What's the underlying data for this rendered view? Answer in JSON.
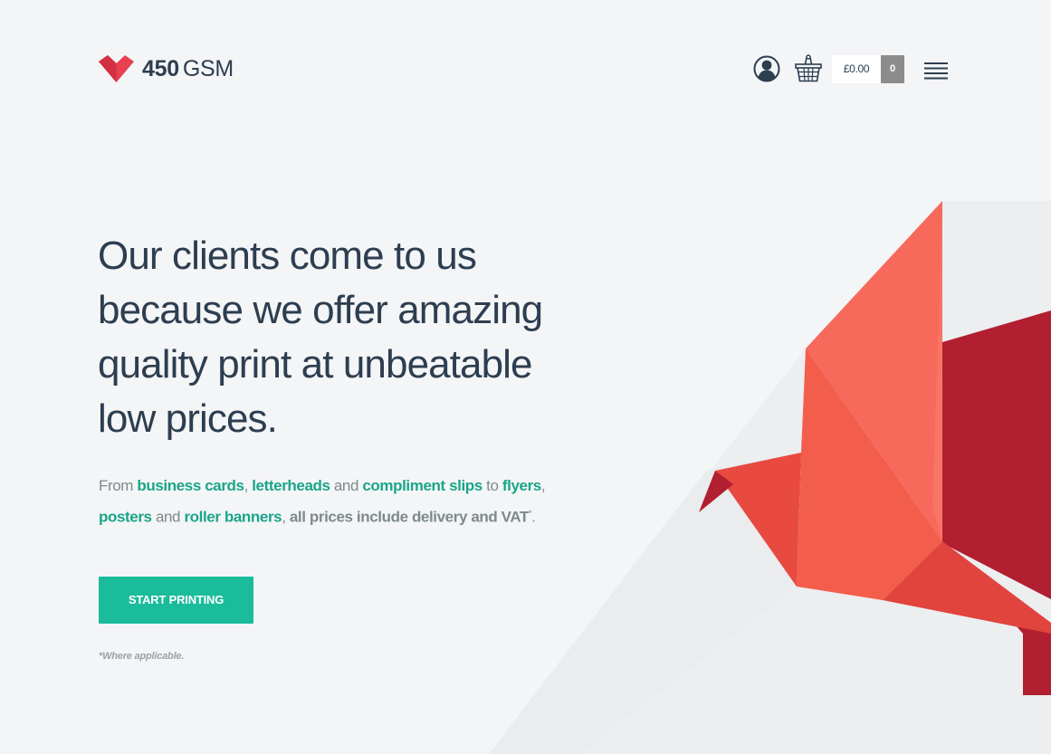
{
  "brand": {
    "logo_number": "450",
    "logo_suffix": "GSM",
    "accent_color": "#e8404f"
  },
  "header": {
    "account_icon": "user-circle-icon",
    "basket_icon": "shopping-basket-icon",
    "cart_total": "£0.00",
    "cart_count": "0",
    "menu_icon": "hamburger-menu-icon"
  },
  "hero": {
    "heading": "Our clients come to us because we offer amazing quality print at unbeatable low prices.",
    "intro": {
      "from": "From",
      "link_business_cards": "business cards",
      "comma1": ",",
      "link_letterheads": "letterheads",
      "and1": "and",
      "link_compliment_slips": "compliment slips",
      "to": "to",
      "link_flyers": "flyers",
      "comma2": ",",
      "link_posters": "posters",
      "and2": "and",
      "link_roller_banners": "roller banners",
      "comma3": ",",
      "prices_note": "all prices include delivery and VAT",
      "asterisk": "*",
      "period": "."
    },
    "cta_label": "START PRINTING",
    "footnote": "*Where applicable."
  },
  "colors": {
    "background": "#f4f5f7",
    "text_dark": "#2d3e50",
    "text_muted": "#7e8a8a",
    "link_green": "#1aa589",
    "button_green": "#1bbc9b",
    "cart_count_bg": "#8c8c8c",
    "bird_coral": "#f6695b",
    "bird_red": "#b21f30"
  },
  "illustration": {
    "icon": "origami-bird-illustration"
  }
}
